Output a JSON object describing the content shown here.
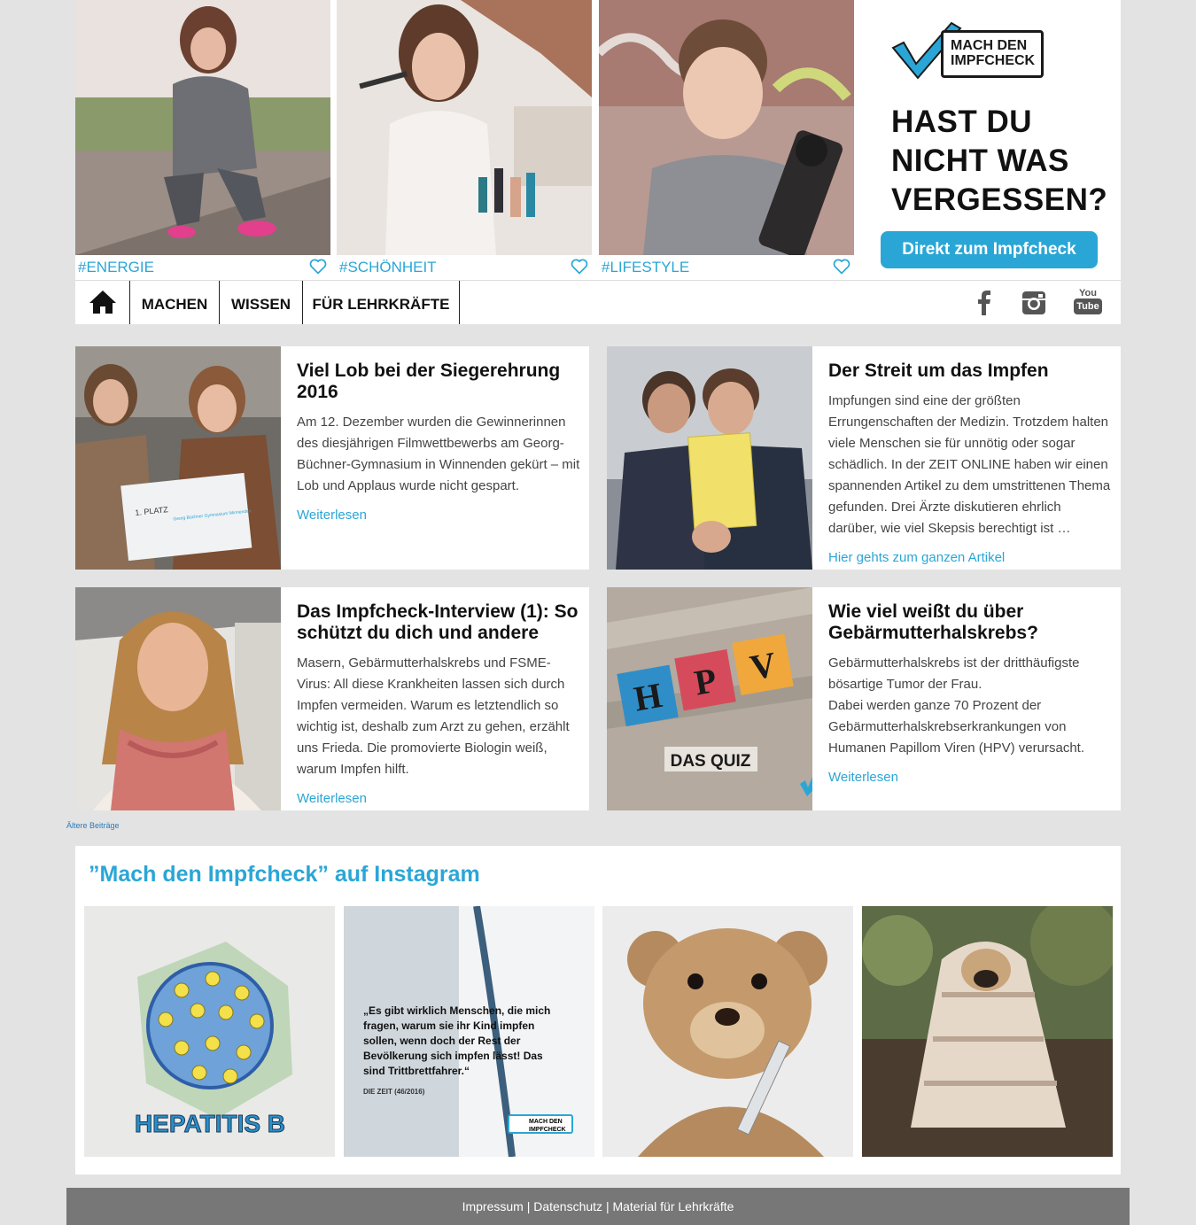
{
  "hero": {
    "tiles": [
      {
        "tag": "#ENERGIE"
      },
      {
        "tag": "#SCHÖNHEIT"
      },
      {
        "tag": "#LIFESTYLE"
      }
    ],
    "promo": {
      "logo_line1": "MACH DEN",
      "logo_line2": "IMPFCHECK",
      "headline_1": "HAST DU",
      "headline_2": "NICHT WAS",
      "headline_3": "VERGESSEN?",
      "button": "Direkt zum Impfcheck"
    }
  },
  "nav": {
    "items": [
      "MACHEN",
      "WISSEN",
      "FÜR LEHRKRÄFTE"
    ],
    "social": [
      "facebook-icon",
      "instagram-icon",
      "youtube-icon"
    ],
    "youtube_top": "You",
    "youtube_bottom": "Tube"
  },
  "cards": [
    {
      "title": "Viel Lob bei der Siegerehrung 2016",
      "body": "Am 12. Dezember wurden die Gewinnerinnen des diesjährigen Filmwettbewerbs am Georg-Büchner-Gymnasium in Winnenden gekürt – mit Lob und Applaus wurde nicht gespart.",
      "link": "Weiterlesen",
      "placard_1": "1. PLATZ",
      "placard_2": "Georg Büchner Gymnasium Winnenden"
    },
    {
      "title": "Der Streit um das Impfen",
      "body": "Impfungen sind eine der größten Errungenschaften der Medizin. Trotzdem halten viele Menschen sie für unnötig oder sogar schädlich. In der ZEIT ONLINE haben wir einen spannenden Artikel zu dem umstrittenen Thema gefunden. Drei Ärzte diskutieren ehrlich darüber, wie viel Skepsis berechtigt ist …",
      "link": "Hier gehts zum ganzen Artikel"
    },
    {
      "title": "Das Impfcheck-Interview (1): So schützt du dich und andere",
      "body": "Masern, Gebärmutterhalskrebs und FSME-Virus: All diese Krankheiten lassen sich durch Impfen vermeiden. Warum es letztendlich so wichtig ist, deshalb zum Arzt zu gehen, erzählt uns Frieda. Die promovierte Biologin weiß, warum Impfen hilft.",
      "link": "Weiterlesen"
    },
    {
      "title": "Wie viel weißt du über Gebärmutterhalskrebs?",
      "body_1": "Gebärmutterhalskrebs ist der dritthäufigste bösartige Tumor der Frau.",
      "body_2": "Dabei werden ganze 70 Prozent der Gebärmutterhalskrebserkrankungen von Humanen Papillom Viren (HPV) verursacht.",
      "link": "Weiterlesen",
      "blocks": [
        "H",
        "P",
        "V"
      ],
      "quiz": "DAS QUIZ"
    }
  ],
  "older": "Ältere Beiträge",
  "instagram": {
    "heading": "”Mach den Impfcheck” auf Instagram",
    "post1_label": "HEPATITIS B",
    "post2_quote": "„Es gibt wirklich Menschen, die mich fragen, warum sie ihr Kind impfen sollen, wenn doch der Rest der Bevölkerung sich impfen lässt! Das sind Trittbrettfahrer.“",
    "post2_source": "DIE ZEIT (46/2016)",
    "post2_logo_1": "MACH DEN",
    "post2_logo_2": "IMPFCHECK"
  },
  "footer": {
    "impressum": "Impressum",
    "datenschutz": "Datenschutz",
    "material": "Material für Lehrkräfte",
    "sep": "|"
  },
  "colors": {
    "accent": "#2aa6d6",
    "page_bg": "#e3e3e3",
    "footer_bg": "#777777"
  }
}
